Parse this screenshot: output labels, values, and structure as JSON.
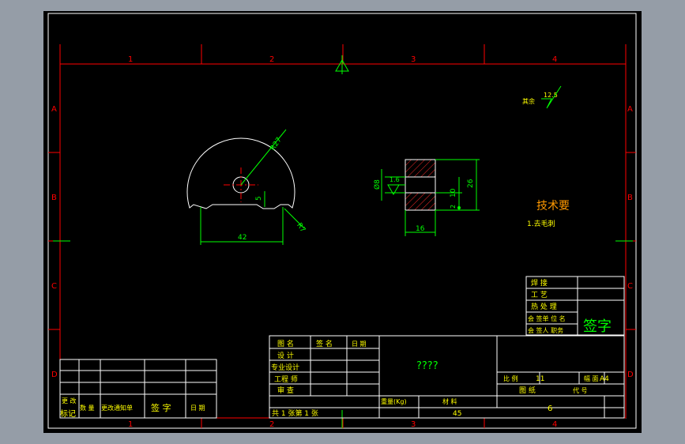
{
  "colors": {
    "background": "#000000",
    "frame": "#ffffff",
    "border_red": "#ff0000",
    "dim_green": "#00ff00",
    "text_yellow": "#ffff00",
    "text_orange": "#ff9900",
    "hatch_red": "#ff2a2a"
  },
  "grid": {
    "columns": [
      "1",
      "2",
      "3",
      "4"
    ],
    "rows": [
      "A",
      "B",
      "C",
      "D"
    ]
  },
  "part_front": {
    "r27": "R27",
    "r7": "R7",
    "d5": "5",
    "d42": "42"
  },
  "part_side": {
    "d8": "Ø8",
    "roughness": "1.6",
    "d26": "26",
    "d10": "10",
    "d2": "2",
    "d16": "16"
  },
  "roughness_note": {
    "label": "其余",
    "value": "12.5"
  },
  "tech_req": {
    "title": "技术要",
    "item1": "1.去毛刺"
  },
  "sign_table": {
    "r1": "焊 接",
    "r2": "工 艺",
    "r3": "热 处 理",
    "r4": "会 签单 位 名",
    "r5": "会 签人 职务",
    "big": "签字"
  },
  "title_block": {
    "col1": [
      "图 名",
      "设 计",
      "专业设计",
      "工程 师",
      "审 查"
    ],
    "col2": "签 名",
    "col3": "日 期",
    "part_name": "????",
    "ratio_label": "比 例",
    "ratio_value": "11",
    "size_label": "幅 面",
    "size_value": "A4",
    "drawing_label": "图 纸",
    "code_label": "代 号",
    "code_value": "6",
    "weight_label": "重量(Kg)",
    "material_label": "材 料",
    "material_value": "45",
    "sheets": "共 1 张第 1 张"
  },
  "revision": {
    "mark": "更 改\n标记",
    "qty": "数 量",
    "doc": "更改通知单",
    "sign": "签 字",
    "date": "日 期"
  }
}
